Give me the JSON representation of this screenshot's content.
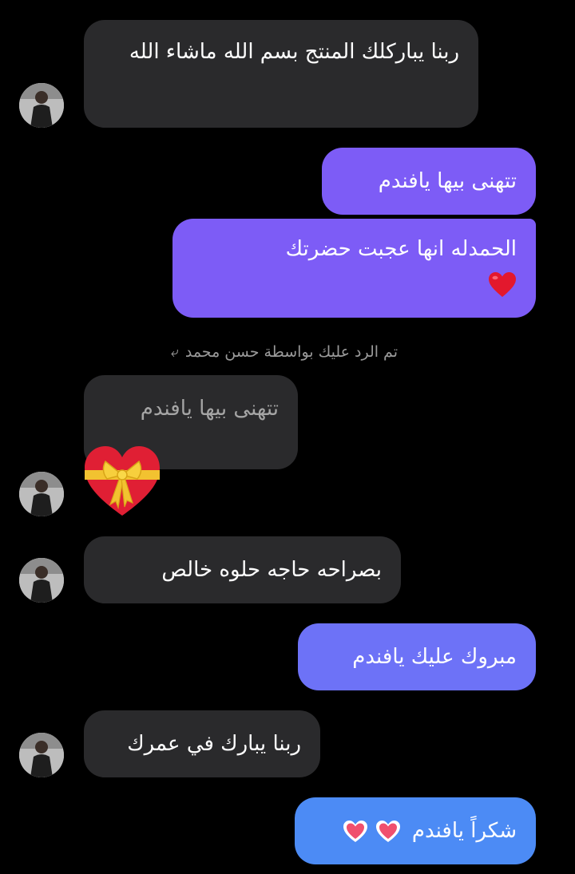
{
  "messages": [
    {
      "id": "m1",
      "side": "incoming",
      "text": "ربنا يباركلك المنتج بسم الله ماشاء الله"
    },
    {
      "id": "m2",
      "side": "outgoing",
      "text": "تتهنى بيها يافندم"
    },
    {
      "id": "m3",
      "side": "outgoing",
      "text": "الحمدله انها عجبت حضرتك",
      "emoji": "red-heart"
    },
    {
      "id": "m4",
      "side": "incoming",
      "reply_label": "تم الرد عليك بواسطة حسن محمد",
      "quoted_text": "تتهنى بيها يافندم",
      "reaction": "heart-with-ribbon"
    },
    {
      "id": "m5",
      "side": "incoming",
      "text": "بصراحه حاجه حلوه خالص"
    },
    {
      "id": "m6",
      "side": "outgoing",
      "text": "مبروك عليك يافندم"
    },
    {
      "id": "m7",
      "side": "incoming",
      "text": "ربنا يبارك في عمرك"
    },
    {
      "id": "m8",
      "side": "outgoing",
      "text": "شكراً يافندم",
      "emoji": "sparkling-heart"
    }
  ],
  "colors": {
    "background": "#000000",
    "incoming_bubble": "#2a2a2c",
    "outgoing_purple": "#7d5cf6",
    "outgoing_indigo": "#6d72f7",
    "outgoing_blue": "#4c8bf5"
  },
  "icons": {
    "reply": "reply-arrow-icon",
    "avatar": "contact-avatar"
  }
}
